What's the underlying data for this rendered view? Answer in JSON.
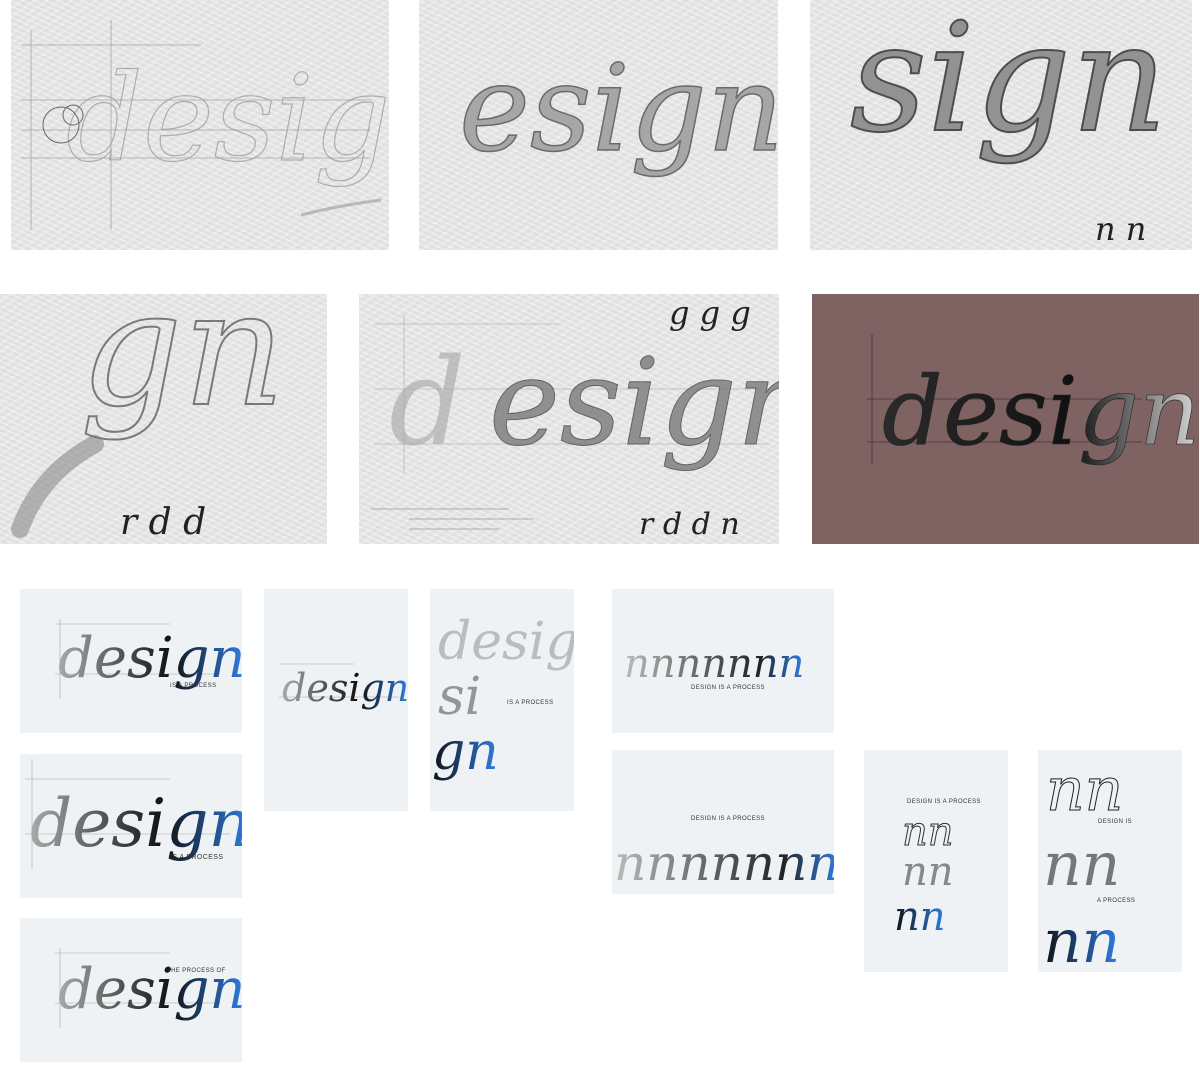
{
  "captions": {
    "process": "IS A PROCESS",
    "the_process_of": "THE PROCESS OF",
    "design_is_a_process": "DESIGN IS A PROCESS",
    "design_is": "DESIGN IS",
    "a_process": "A PROCESS"
  },
  "colors": {
    "paper": "#e9e9e9",
    "poster": "#eef2f4",
    "mauve": "#7f6262",
    "accent_blue": "#2f7fe8"
  }
}
